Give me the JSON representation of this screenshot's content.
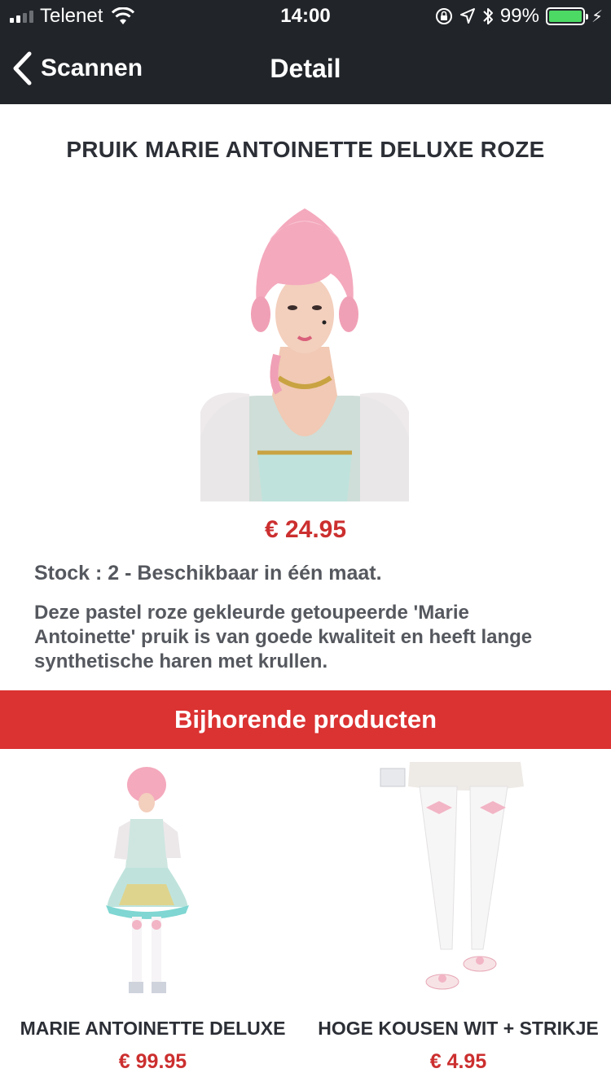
{
  "status_bar": {
    "carrier": "Telenet",
    "time": "14:00",
    "battery_percent": "99%",
    "signal_bars": 2,
    "battery_level": 0.99
  },
  "nav": {
    "back_label": "Scannen",
    "title": "Detail"
  },
  "product": {
    "title": "PRUIK MARIE ANTOINETTE DELUXE ROZE",
    "price": "€ 24.95",
    "stock": "Stock : 2 - Beschikbaar in één maat.",
    "description": "Deze pastel roze gekleurde getoupeerde 'Marie Antoinette' pruik is van goede kwaliteit en heeft lange synthetische haren met krullen."
  },
  "related": {
    "header": "Bijhorende producten",
    "items": [
      {
        "name": "MARIE ANTOINETTE DELUXE",
        "price": "€ 99.95"
      },
      {
        "name": "HOGE KOUSEN WIT + STRIKJE",
        "price": "€ 4.95"
      }
    ]
  },
  "colors": {
    "bar_background": "#212429",
    "accent_red": "#db3232",
    "price_red": "#cc2f2f",
    "battery_green": "#4cd964"
  }
}
